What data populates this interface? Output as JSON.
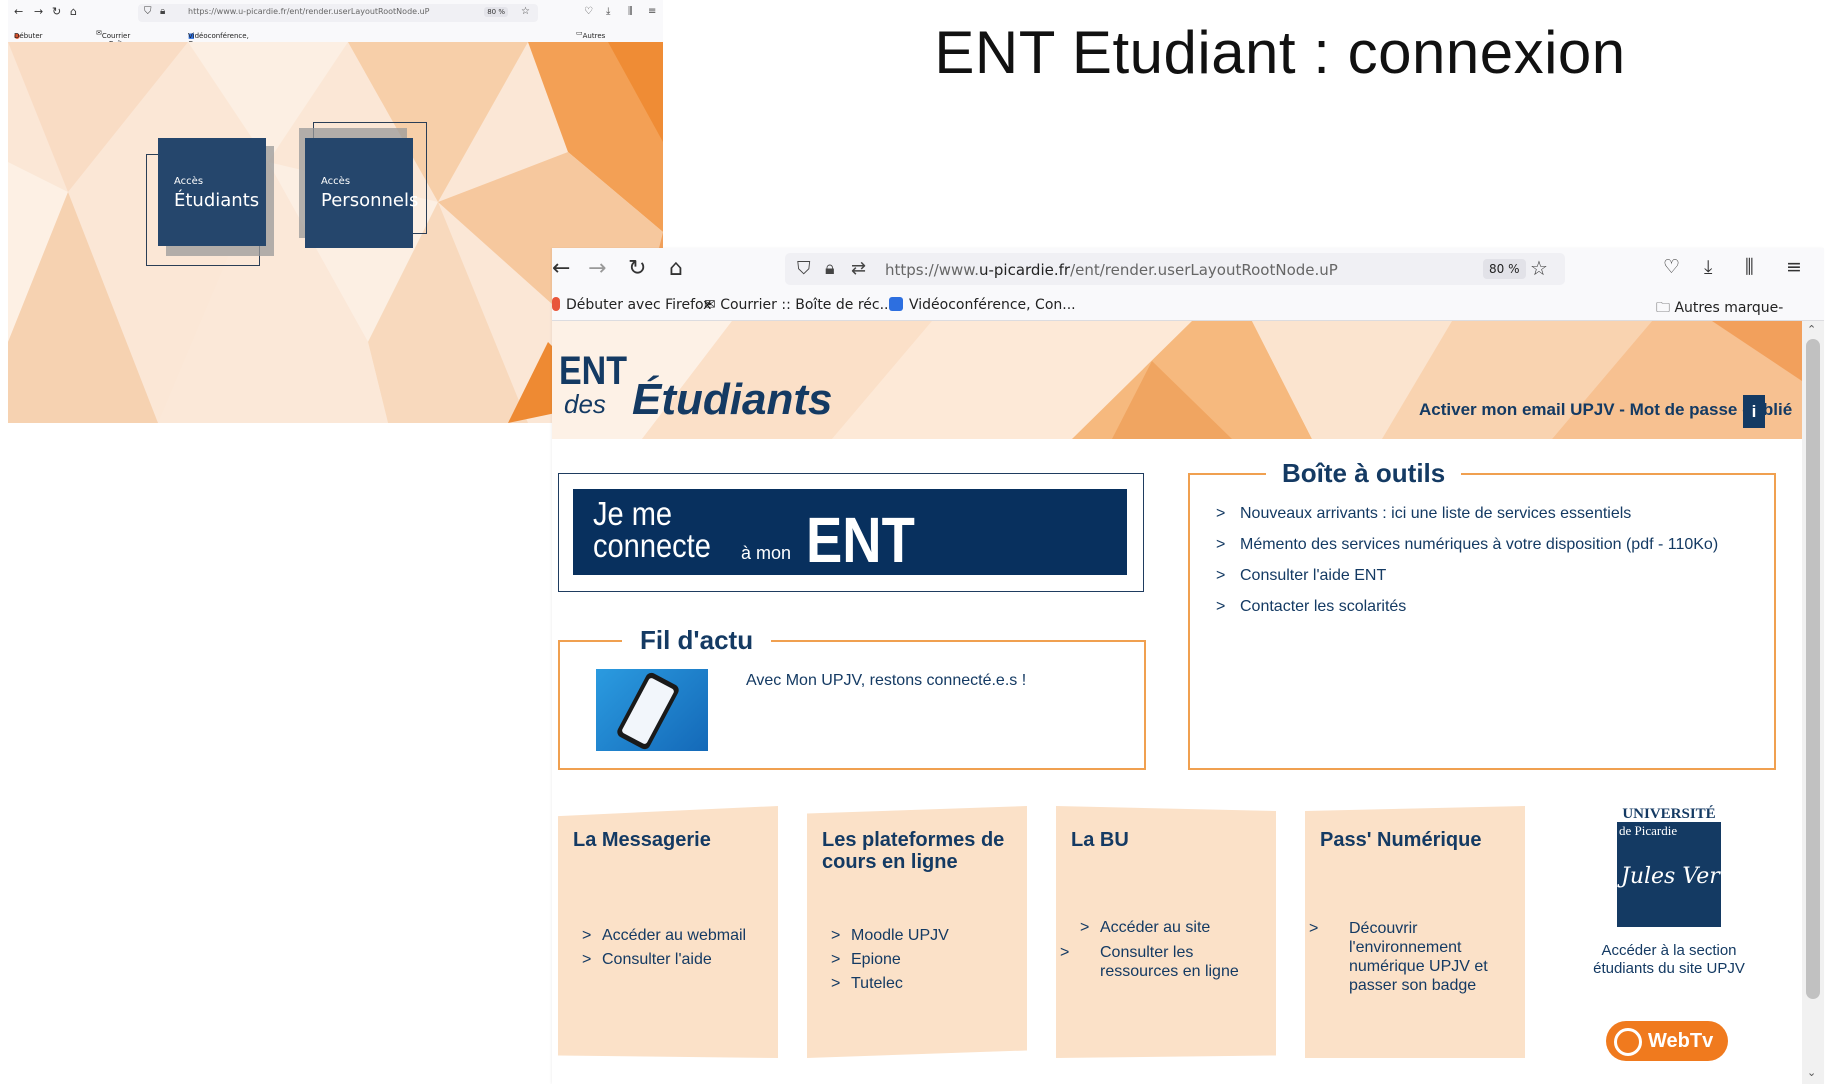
{
  "slide": {
    "title": "ENT Etudiant : connexion"
  },
  "small_browser": {
    "url": "https://www.u-picardie.fr/ent/render.userLayoutRootNode.uP",
    "zoom": "80 %",
    "bookmarks": [
      "Débuter avec Firefox",
      "Courrier :: Boîte de réc...",
      "Vidéoconférence, Con..."
    ],
    "other_bookmarks": "Autres marque-pages",
    "tile_students": {
      "small": "Accès",
      "big": "Étudiants"
    },
    "tile_staff": {
      "small": "Accès",
      "big": "Personnels"
    }
  },
  "large_browser": {
    "url_prefix": "https://www.",
    "url_domain": "u-picardie.fr",
    "url_path": "/ent/render.userLayoutRootNode.uP",
    "zoom": "80 %",
    "bookmarks": [
      "Débuter avec Firefox",
      "Courrier :: Boîte de réc...",
      "Vidéoconférence, Con..."
    ],
    "other_bookmarks": "Autres marque-pages",
    "icons": [
      "back-arrow-icon",
      "forward-arrow-icon",
      "reload-icon",
      "home-icon",
      "shield-icon",
      "lock-icon",
      "permissions-icon",
      "star-icon",
      "pocket-icon",
      "download-icon",
      "library-icon",
      "menu-icon",
      "folder-icon"
    ]
  },
  "ent": {
    "logo": {
      "ent": "ENT",
      "des": "des",
      "etudiants": "Étudiants"
    },
    "banner_link": "Activer mon email UPJV - Mot de passe oublié",
    "info_label": "i",
    "connect": {
      "line1": "Je me",
      "line2": "connecte",
      "small": "à mon",
      "ent": "ENT"
    },
    "fil": {
      "title": "Fil d'actu",
      "item": "Avec Mon UPJV, restons connecté.e.s !"
    },
    "toolbox": {
      "title": "Boîte à outils",
      "links": [
        "Nouveaux arrivants : ici une liste de services essentiels",
        "Mémento des services numériques à votre disposition (pdf - 110Ko)",
        "Consulter l'aide ENT",
        "Contacter les scolarités"
      ]
    },
    "tiles": [
      {
        "title": "La Messagerie",
        "links": [
          "Accéder au webmail",
          "Consulter l'aide"
        ]
      },
      {
        "title": "Les plateformes de cours en ligne",
        "links": [
          "Moodle UPJV",
          "Epione",
          "Tutelec"
        ]
      },
      {
        "title": "La BU",
        "links": [
          "Accéder au site",
          "Consulter les ressources en ligne"
        ]
      },
      {
        "title": "Pass' Numérique",
        "links": [
          "Découvrir l'environnement numérique UPJV et passer son badge"
        ]
      }
    ],
    "upjv": {
      "name": "UNIVERSITÉ",
      "de": "de Picardie",
      "signature": "Jules Verne",
      "caption": "Accéder à la section étudiants du site UPJV"
    },
    "webtv": "WebTv",
    "gt": ">"
  },
  "colors": {
    "navy": "#143a63",
    "orange": "#f0a050",
    "tile_bg": "#fbe1c8",
    "tile_dark": "#25466c",
    "webtv": "#f07a1e"
  }
}
